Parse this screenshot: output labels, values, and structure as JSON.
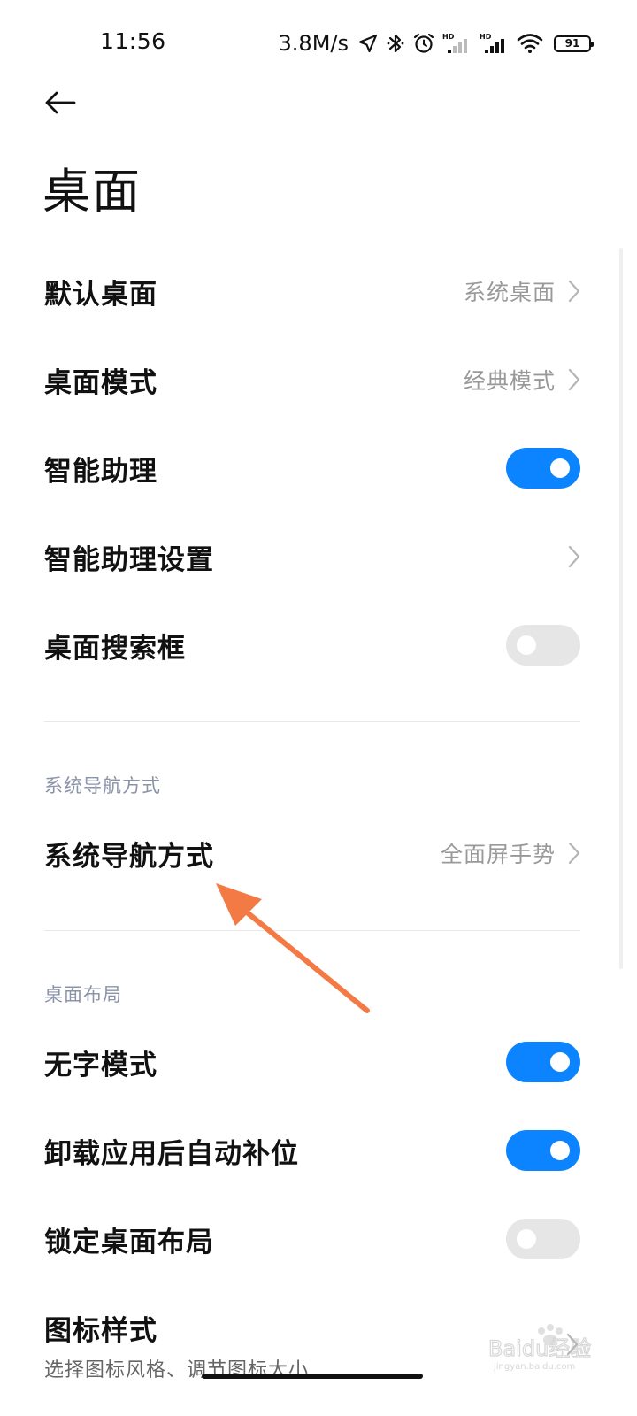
{
  "status_bar": {
    "time": "11:56",
    "net_speed": "3.8M/s",
    "battery": "91",
    "icons": [
      "location-icon",
      "bluetooth-icon",
      "alarm-icon",
      "hd-signal-icon",
      "hd-signal-icon",
      "wifi-icon",
      "battery-icon"
    ]
  },
  "header": {
    "back_icon": "back-arrow-icon",
    "title": "桌面"
  },
  "items": [
    {
      "label": "默认桌面",
      "value": "系统桌面",
      "type": "link"
    },
    {
      "label": "桌面模式",
      "value": "经典模式",
      "type": "link"
    },
    {
      "label": "智能助理",
      "type": "toggle",
      "enabled": true
    },
    {
      "label": "智能助理设置",
      "type": "link"
    },
    {
      "label": "桌面搜索框",
      "type": "toggle",
      "enabled": false
    }
  ],
  "nav_section": {
    "header": "系统导航方式",
    "items": [
      {
        "label": "系统导航方式",
        "value": "全面屏手势",
        "type": "link"
      }
    ]
  },
  "layout_section": {
    "header": "桌面布局",
    "items": [
      {
        "label": "无字模式",
        "type": "toggle",
        "enabled": true
      },
      {
        "label": "卸载应用后自动补位",
        "type": "toggle",
        "enabled": true
      },
      {
        "label": "锁定桌面布局",
        "type": "toggle",
        "enabled": false
      },
      {
        "label": "图标样式",
        "subtitle": "选择图标风格、调节图标大小",
        "type": "link"
      }
    ]
  },
  "colors": {
    "accent": "#0d84ff",
    "toggle_off": "#e6e6e6",
    "annotation_arrow": "#f47a45",
    "secondary_text": "#999999",
    "section_header": "#8a93a8"
  },
  "watermark": {
    "text": "Baidu经验",
    "url_text": "jingyan.baidu.com"
  }
}
